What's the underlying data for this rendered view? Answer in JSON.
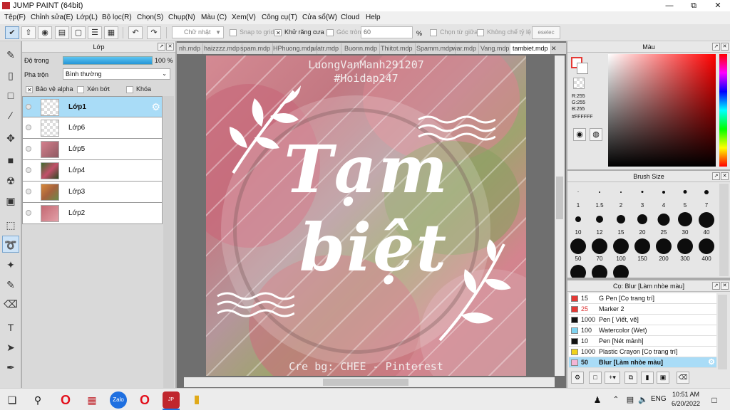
{
  "window": {
    "title": "JUMP PAINT (64bit)",
    "minimize": "—",
    "maximize": "⧉",
    "close": "✕"
  },
  "menu": [
    "Tệp(F)",
    "Chỉnh sửa(E)",
    "Lớp(L)",
    "Bộ lọc(R)",
    "Chọn(S)",
    "Chụp(N)",
    "Màu (C)",
    "Xem(V)",
    "Công cụ(T)",
    "Cửa sổ(W)",
    "Cloud",
    "Help"
  ],
  "toolbar": {
    "shape_select": "Chữ nhật",
    "snap_grid": "Snap to grid",
    "antialias": "Khử răng cưa",
    "corner": "Góc tròn",
    "corner_value": "60",
    "percent": "%",
    "select_center": "Chọn từ giữa",
    "no_ratio": "Không chế tỷ lệ",
    "deselect": "eselec"
  },
  "layers": {
    "panel_title": "Lớp",
    "opacity_label": "Độ trong",
    "opacity_value": "100 %",
    "opacity_fraction": 1.0,
    "blend_label": "Pha trộn",
    "blend_value": "Bình thường",
    "protect_alpha": "Bảo vệ alpha",
    "clipping": "Xén bớt",
    "lock": "Khóa",
    "items": [
      {
        "name": "Lớp1",
        "selected": true,
        "thumb": "empty"
      },
      {
        "name": "Lớp6",
        "selected": false,
        "thumb": "empty"
      },
      {
        "name": "Lớp5",
        "selected": false,
        "thumb": "pink"
      },
      {
        "name": "Lớp4",
        "selected": false,
        "thumb": "green"
      },
      {
        "name": "Lớp3",
        "selected": false,
        "thumb": "orange"
      },
      {
        "name": "Lớp2",
        "selected": false,
        "thumb": "pink"
      }
    ]
  },
  "tabs": [
    "nh.mdp",
    "haizzzz.mdp",
    "spam.mdp",
    "HPhuong.mdp",
    "ulatr.mdp",
    "Buonn.mdp",
    "Thiitot.mdp",
    "Spamm.mdp",
    "war.mdp",
    "Vang.mdp",
    "tambiet.mdp"
  ],
  "active_tab": "tambiet.mdp",
  "artwork": {
    "credit_top": "LuongVanManh291207",
    "hashtag": "#Hoidap247",
    "line1": "Tạm",
    "line2": "biệt",
    "credit_bottom": "Cre bg: CHEE - Pinterest"
  },
  "color": {
    "panel_title": "Màu",
    "r": "R:255",
    "g": "G:255",
    "b": "B:255",
    "hex": "#FFFFFF",
    "foreground": "#ffffff",
    "accent": "#ff0000"
  },
  "brush_size": {
    "panel_title": "Brush Size",
    "sizes": [
      "1",
      "1.5",
      "2",
      "3",
      "4",
      "5",
      "7",
      "10",
      "12",
      "15",
      "20",
      "25",
      "30",
      "40",
      "50",
      "70",
      "100",
      "150",
      "200",
      "300",
      "400"
    ]
  },
  "brush_list": {
    "panel_title": "Cọ: Blur [Làm nhòe màu]",
    "items": [
      {
        "size": "15",
        "name": "G Pen [Cọ trang trí]",
        "color": "#e53935",
        "size_color": "#222"
      },
      {
        "size": "25",
        "name": "Marker 2",
        "color": "#e53935",
        "size_color": "#d33"
      },
      {
        "size": "1000",
        "name": "Pen [ Viết, vẽ]",
        "color": "#111111",
        "size_color": "#222"
      },
      {
        "size": "100",
        "name": "Watercolor (Wet)",
        "color": "#7fd3f0",
        "size_color": "#222"
      },
      {
        "size": "10",
        "name": "Pen [Nét mảnh]",
        "color": "#111111",
        "size_color": "#222"
      },
      {
        "size": "1000",
        "name": "Plastic Crayon [Cọ trang trí]",
        "color": "#f0d21b",
        "size_color": "#222"
      },
      {
        "size": "50",
        "name": "Blur [Làm nhòe màu]",
        "color": "#f3b5d6",
        "size_color": "#222"
      }
    ]
  },
  "taskbar": {
    "lang": "ENG",
    "time": "10:51 AM",
    "date": "6/20/2022"
  }
}
